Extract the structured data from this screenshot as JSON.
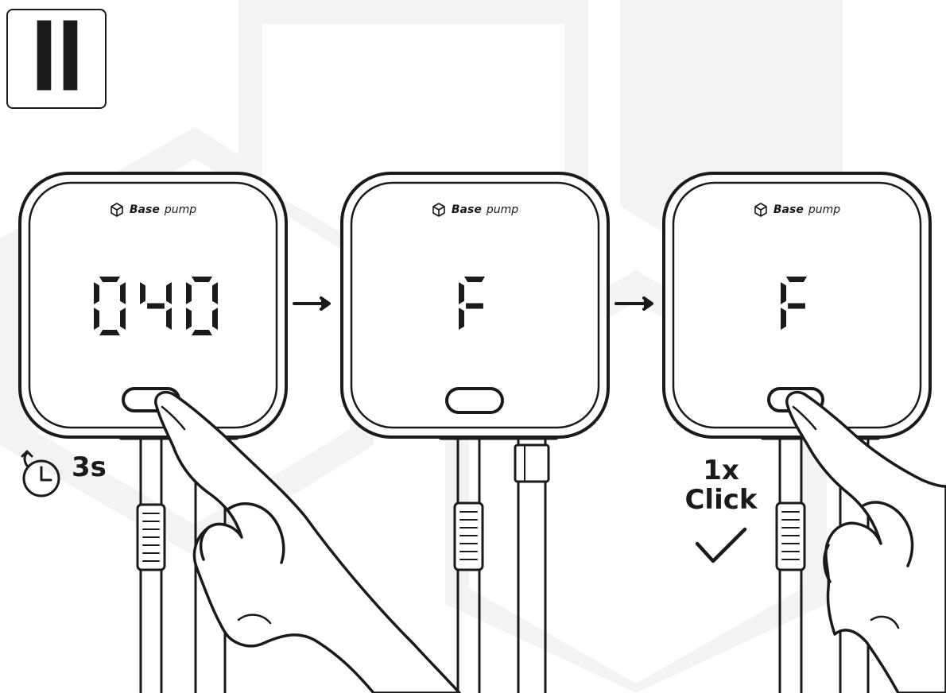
{
  "step": {
    "numeral": "II"
  },
  "panels": [
    {
      "brand_bold": "Base",
      "brand_light": "pump",
      "display_value": "040"
    },
    {
      "brand_bold": "Base",
      "brand_light": "pump",
      "display_value": "F"
    },
    {
      "brand_bold": "Base",
      "brand_light": "pump",
      "display_value": "F"
    }
  ],
  "hold_caption": {
    "duration": "3s",
    "icon": "stopwatch-icon"
  },
  "click_caption": {
    "count": "1x",
    "action": "Click",
    "icon": "check-icon"
  },
  "arrows": [
    "arrow-right-icon",
    "arrow-right-icon"
  ],
  "colors": {
    "ink": "#1a1a1a",
    "watermark": "#f3f3f3",
    "paper": "#ffffff"
  }
}
